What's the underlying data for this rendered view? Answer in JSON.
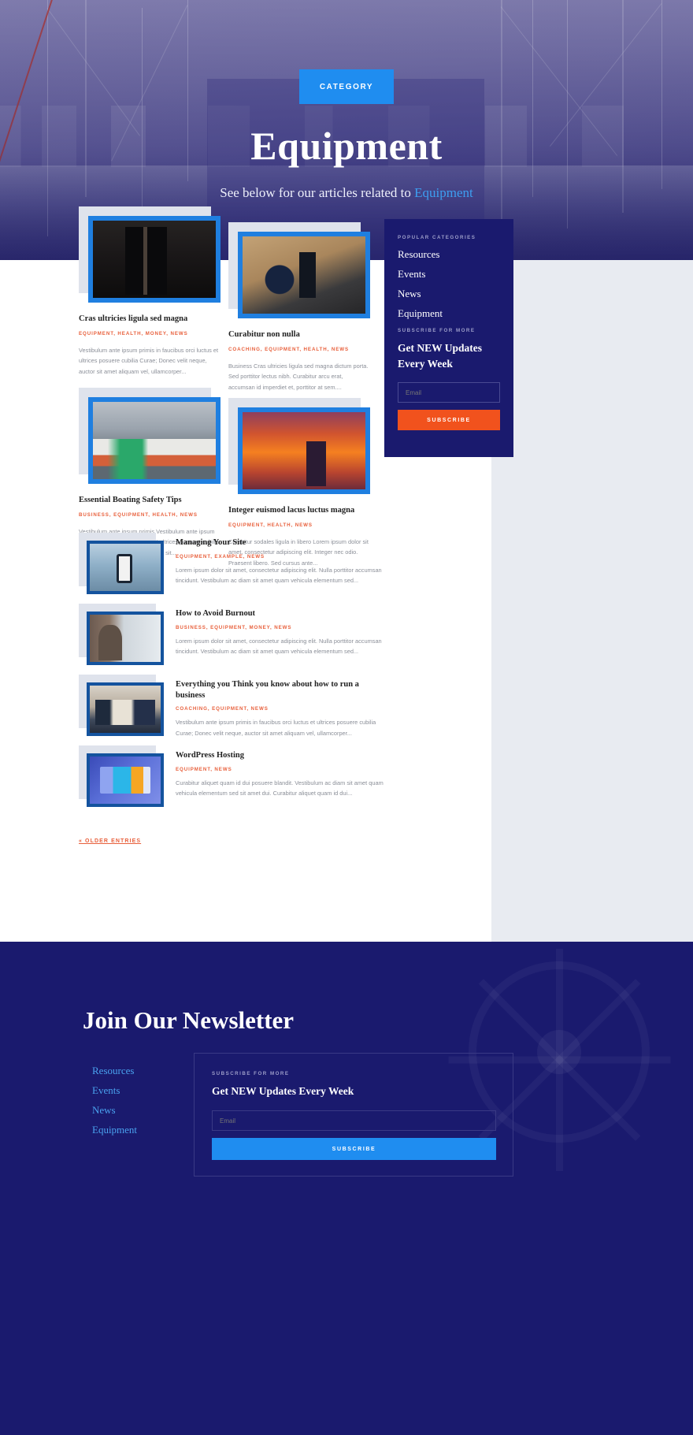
{
  "hero": {
    "badge": "CATEGORY",
    "title": "Equipment",
    "subtitle_prefix": "See below for our articles related to ",
    "subtitle_highlight": "Equipment"
  },
  "grid_cards": [
    {
      "title": "Cras ultricies ligula sed magna",
      "categories": "EQUIPMENT, HEALTH, MONEY, NEWS",
      "excerpt": "Vestibulum ante ipsum primis in faucibus orci luctus et ultrices posuere cubilia Curae; Donec velit neque, auctor sit amet aliquam vel, ullamcorper...",
      "image": "suits-hallway"
    },
    {
      "title": "Curabitur non nulla",
      "categories": "COACHING, EQUIPMENT, HEALTH, NEWS",
      "excerpt": "Business Cras ultricies ligula sed magna dictum porta. Sed porttitor lectus nibh. Curabitur arcu erat, accumsan id imperdiet et, porttitor at sem....",
      "image": "desk-overhead"
    },
    {
      "title": "Essential Boating Safety Tips",
      "categories": "BUSINESS, EQUIPMENT, HEALTH, NEWS",
      "excerpt": "Vestibulum ante ipsum primis Vestibulum ante ipsum primis in faucibus orci luctus et ultrices posuere cubilia Curae; Donec velit neque, auctor sit...",
      "image": "boat-dock"
    },
    {
      "title": "Integer euismod lacus luctus magna",
      "categories": "EQUIPMENT, HEALTH, NEWS",
      "excerpt": "Curabitur sodales ligula in libero Lorem ipsum dolor sit amet, consectetur adipiscing elit. Integer nec odio. Praesent libero. Sed cursus ante...",
      "image": "sunset-fjord"
    }
  ],
  "list_posts": [
    {
      "title": "Managing Your Site",
      "categories": "EQUIPMENT, EXAMPLE, NEWS",
      "excerpt": "Lorem ipsum dolor sit amet, consectetur adipiscing elit. Nulla porttitor accumsan tincidunt. Vestibulum ac diam sit amet quam vehicula elementum sed...",
      "image": "phone-landscape"
    },
    {
      "title": "How to Avoid Burnout",
      "categories": "BUSINESS, EQUIPMENT, MONEY, NEWS",
      "excerpt": "Lorem ipsum dolor sit amet, consectetur adipiscing elit. Nulla porttitor accumsan tincidunt. Vestibulum ac diam sit amet quam vehicula elementum sed...",
      "image": "woman-window"
    },
    {
      "title": "Everything you Think you know about how to run a business",
      "categories": "COACHING, EQUIPMENT, NEWS",
      "excerpt": "Vestibulum ante ipsum primis in faucibus orci luctus et ultrices posuere cubilia Curae; Donec velit neque, auctor sit amet aliquam vel, ullamcorper...",
      "image": "meeting-table"
    },
    {
      "title": "WordPress Hosting",
      "categories": "EQUIPMENT, NEWS",
      "excerpt": "Curabitur aliquet quam id dui posuere blandit. Vestibulum ac diam sit amet quam vehicula elementum sed sit amet dui. Curabitur aliquet quam id dui...",
      "image": "wordpress-illustration"
    }
  ],
  "pagination": {
    "older_label": "« OLDER ENTRIES"
  },
  "sidebar": {
    "categories_eyebrow": "POPULAR CATEGORIES",
    "categories": [
      "Resources",
      "Events",
      "News",
      "Equipment"
    ],
    "subscribe_eyebrow": "SUBSCRIBE FOR MORE",
    "subscribe_heading": "Get NEW Updates Every Week",
    "email_placeholder": "Email",
    "subscribe_label": "SUBSCRIBE"
  },
  "footer": {
    "title": "Join Our Newsletter",
    "links": [
      "Resources",
      "Events",
      "News",
      "Equipment"
    ],
    "subscribe_eyebrow": "SUBSCRIBE FOR MORE",
    "subscribe_heading": "Get NEW Updates Every Week",
    "email_placeholder": "Email",
    "subscribe_label": "SUBSCRIBE"
  },
  "colors": {
    "accent_blue": "#1f8df0",
    "deep_navy": "#1a1a6e",
    "orange": "#f1521d",
    "cat_orange": "#e8603c",
    "frame_blue": "#14539e"
  }
}
